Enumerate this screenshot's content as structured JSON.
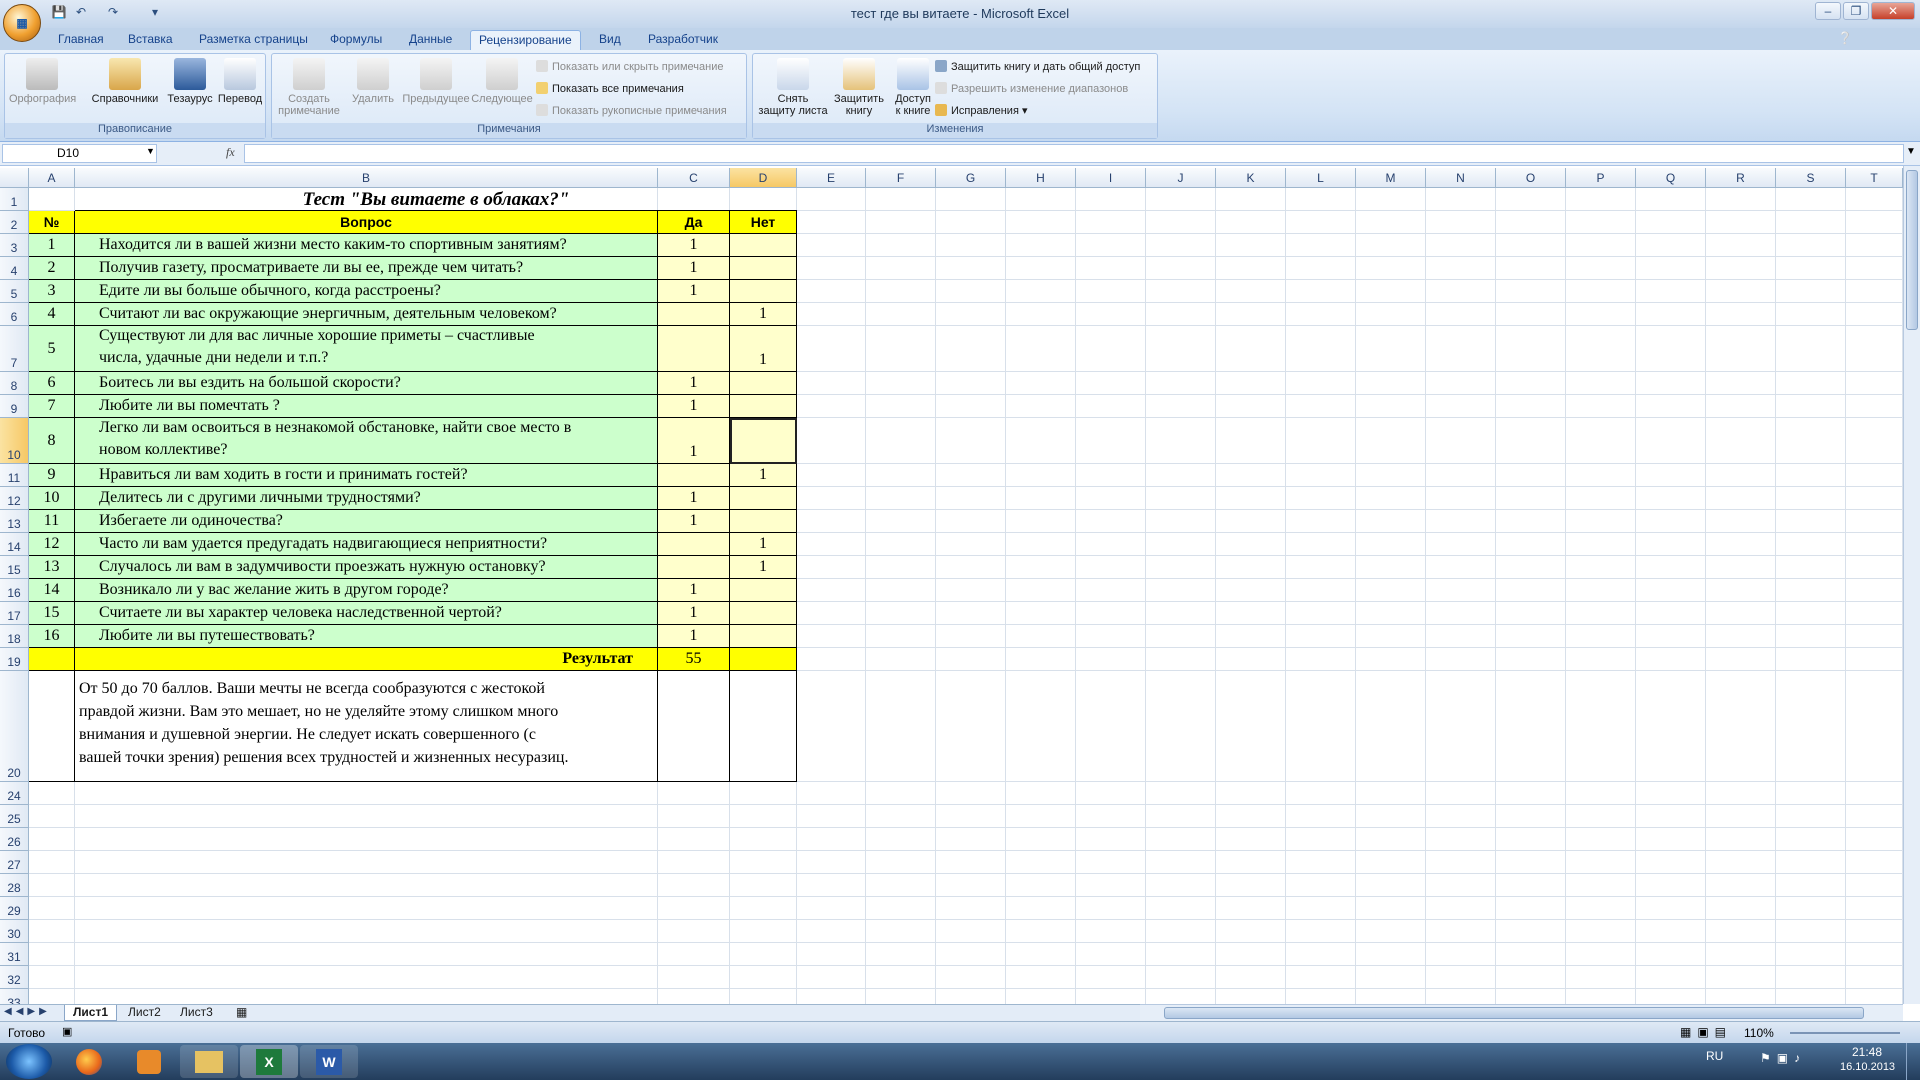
{
  "window": {
    "title": "тест где вы витаете - Microsoft Excel"
  },
  "tabs": [
    "Главная",
    "Вставка",
    "Разметка страницы",
    "Формулы",
    "Данные",
    "Рецензирование",
    "Вид",
    "Разработчик"
  ],
  "active_tab": "Рецензирование",
  "ribbon": {
    "proofing": {
      "label": "Правописание",
      "spelling": "Орфография",
      "research": "Справочники",
      "thesaurus": "Тезаурус",
      "translate": "Перевод"
    },
    "comments": {
      "label": "Примечания",
      "new_line1": "Создать",
      "new_line2": "примечание",
      "delete": "Удалить",
      "previous": "Предыдущее",
      "next": "Следующее",
      "show_hide": "Показать или скрыть примечание",
      "show_all": "Показать все примечания",
      "show_ink": "Показать рукописные примечания"
    },
    "changes": {
      "label": "Изменения",
      "unprotect_line1": "Снять",
      "unprotect_line2": "защиту листа",
      "protect_wb_line1": "Защитить",
      "protect_wb_line2": "книгу",
      "share_line1": "Доступ",
      "share_line2": "к книге",
      "protect_share": "Защитить книгу и дать общий доступ",
      "allow_ranges": "Разрешить изменение диапазонов",
      "track": "Исправления"
    }
  },
  "formula_bar": {
    "name_box": "D10",
    "fx": "fx",
    "formula": ""
  },
  "columns": [
    "A",
    "B",
    "C",
    "D",
    "E",
    "F",
    "G",
    "H",
    "I",
    "J",
    "K",
    "L",
    "M",
    "N",
    "O",
    "P",
    "Q",
    "R",
    "S",
    "T"
  ],
  "selected_column": "D",
  "row_numbers": [
    "1",
    "2",
    "3",
    "4",
    "5",
    "6",
    "7",
    "8",
    "9",
    "10",
    "11",
    "12",
    "13",
    "14",
    "15",
    "16",
    "17",
    "18",
    "19",
    "20",
    "24",
    "25",
    "26",
    "27",
    "28",
    "29",
    "30",
    "31",
    "32",
    "33"
  ],
  "sheet": {
    "title": "Тест \"Вы витаете в облаках?\"",
    "headers": {
      "num": "№",
      "question": "Вопрос",
      "yes": "Да",
      "no": "Нет"
    },
    "rows": [
      {
        "n": "1",
        "q": "Находится ли в вашей жизни место каким-то спортивным занятиям?",
        "yes": "1",
        "no": ""
      },
      {
        "n": "2",
        "q": "Получив газету, просматриваете ли вы ее, прежде чем читать?",
        "yes": "1",
        "no": ""
      },
      {
        "n": "3",
        "q": "Едите ли вы больше обычного, когда расстроены?",
        "yes": "1",
        "no": ""
      },
      {
        "n": "4",
        "q": "Считают ли вас окружающие энергичным, деятельным человеком?",
        "yes": "",
        "no": "1"
      },
      {
        "n": "5",
        "q": " Существуют ли для вас личные хорошие приметы – счастливые",
        "q2": "числа, удачные дни недели и т.п.?",
        "yes": "",
        "no": "1"
      },
      {
        "n": "6",
        "q": " Боитесь ли вы ездить на большой скорости?",
        "yes": "1",
        "no": ""
      },
      {
        "n": "7",
        "q": "Любите ли вы помечтать ?",
        "yes": "1",
        "no": ""
      },
      {
        "n": "8",
        "q": "Легко ли вам освоиться в незнакомой обстановке, найти свое место в",
        "q2": "новом коллективе?",
        "yes": "1",
        "no": ""
      },
      {
        "n": "9",
        "q": "Нравиться ли вам ходить в гости и принимать гостей?",
        "yes": "",
        "no": "1"
      },
      {
        "n": "10",
        "q": "Делитесь ли с другими личными трудностями?",
        "yes": "1",
        "no": ""
      },
      {
        "n": "11",
        "q": "Избегаете ли одиночества?",
        "yes": "1",
        "no": ""
      },
      {
        "n": "12",
        "q": "Часто ли вам удается предугадать надвигающиеся неприятности?",
        "yes": "",
        "no": "1"
      },
      {
        "n": "13",
        "q": "Случалось ли вам в задумчивости проезжать нужную остановку?",
        "yes": "",
        "no": "1"
      },
      {
        "n": "14",
        "q": "Возникало ли у вас желание жить в другом городе?",
        "yes": "1",
        "no": ""
      },
      {
        "n": "15",
        "q": "Считаете ли вы характер человека наследственной чертой?",
        "yes": "1",
        "no": ""
      },
      {
        "n": "16",
        "q": "Любите ли вы путешествовать?",
        "yes": "1",
        "no": ""
      }
    ],
    "result_label": "Результат",
    "result_value": "55",
    "conclusion": [
      "От 50 до 70 баллов. Ваши мечты не всегда сообразуются с жестокой",
      "правдой жизни. Вам это мешает, но не уделяйте этому слишком много",
      "внимания и душевной энергии. Не следует искать совершенного (с",
      "вашей точки зрения) решения всех трудностей и жизненных несуразиц."
    ]
  },
  "sheet_tabs": [
    "Лист1",
    "Лист2",
    "Лист3"
  ],
  "status": {
    "ready": "Готово",
    "zoom": "110%"
  },
  "taskbar": {
    "lang": "RU",
    "time": "21:48",
    "date": "16.10.2013"
  }
}
